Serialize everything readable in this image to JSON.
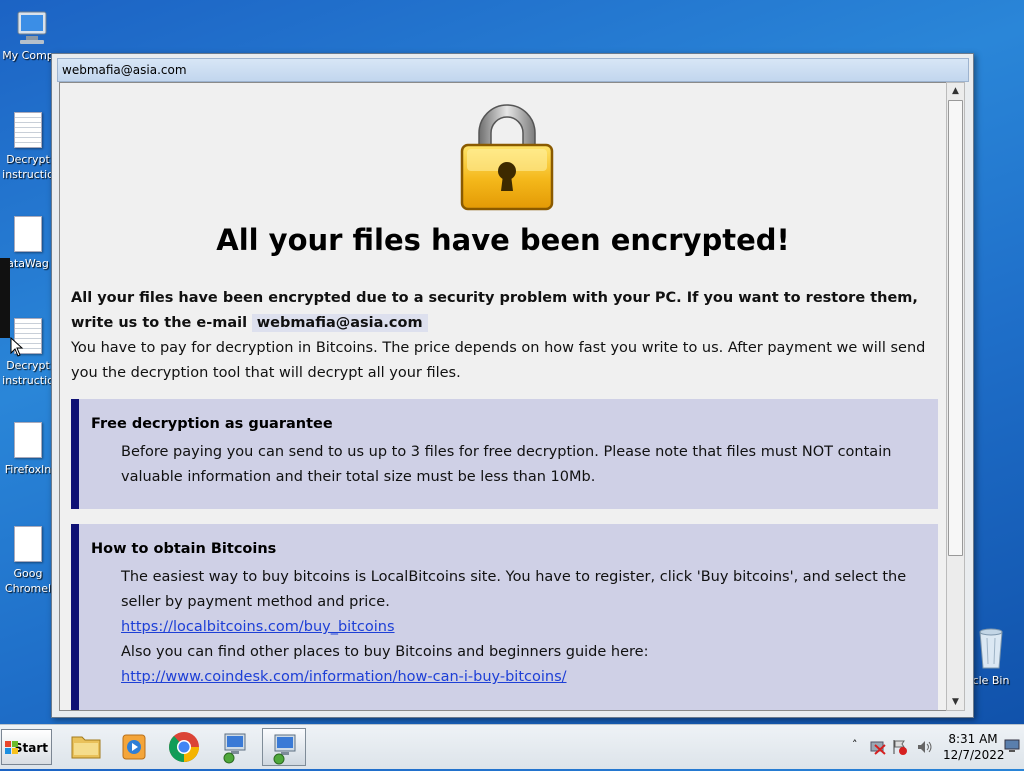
{
  "desktop": {
    "icons": [
      {
        "label": "My Comp"
      },
      {
        "label": "Decrypt",
        "label2": "instructio"
      },
      {
        "label": "ataWag"
      },
      {
        "label": "Decrypt",
        "label2": "instructio"
      },
      {
        "label": "Firefoxln"
      },
      {
        "label": "Goog",
        "label2": "Chromel"
      }
    ],
    "recycle_label": "cle Bin"
  },
  "window": {
    "title": "webmafia@asia.com",
    "heading": "All your files have been encrypted!",
    "intro_bold": "All your files have been encrypted due to a security problem with your PC. If you want to restore them, write us to the e-mail",
    "intro_email": "webmafia@asia.com",
    "intro_rest": "You have to pay for decryption in Bitcoins. The price depends on how fast you write to us. After payment we will send you the decryption tool that will decrypt all your files.",
    "box1": {
      "title": "Free decryption as guarantee",
      "body": "Before paying you can send to us up to 3 files for free decryption. Please note that files must NOT contain valuable information and their total size must be less than 10Mb."
    },
    "box2": {
      "title": "How to obtain Bitcoins",
      "body1": "The easiest way to buy bitcoins is LocalBitcoins site. You have to register, click 'Buy bitcoins', and select the seller by payment method and price.",
      "link1": "https://localbitcoins.com/buy_bitcoins",
      "body2": "Also you can find other places to buy Bitcoins and beginners guide here:",
      "link2": "http://www.coindesk.com/information/how-can-i-buy-bitcoins/"
    }
  },
  "taskbar": {
    "start_label": "Start",
    "clock_time": "8:31 AM",
    "clock_date": "12/7/2022"
  },
  "colors": {
    "box_bg": "#cfd0e6",
    "box_border": "#0f1175",
    "link": "#1d3fd6"
  }
}
